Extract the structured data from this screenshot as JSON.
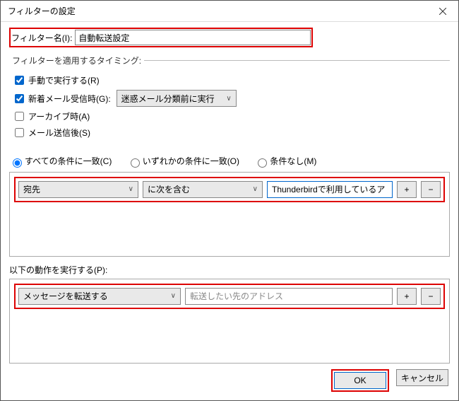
{
  "window": {
    "title": "フィルターの設定"
  },
  "filterName": {
    "label": "フィルター名(I):",
    "value": "自動転送設定"
  },
  "timing": {
    "legend": "フィルターを適用するタイミング:",
    "manual": {
      "label": "手動で実行する(R)",
      "checked": true
    },
    "newmail": {
      "label": "新着メール受信時(G):",
      "checked": true,
      "option": "迷惑メール分類前に実行"
    },
    "archive": {
      "label": "アーカイブ時(A)",
      "checked": false
    },
    "aftersend": {
      "label": "メール送信後(S)",
      "checked": false
    }
  },
  "match": {
    "all": "すべての条件に一致(C)",
    "any": "いずれかの条件に一致(O)",
    "none": "条件なし(M)",
    "selected": "all"
  },
  "condition": {
    "field": "宛先",
    "operator": "に次を含む",
    "value": "Thunderbirdで利用しているアドレス",
    "plus": "+",
    "minus": "−"
  },
  "actions": {
    "label": "以下の動作を実行する(P):",
    "action": "メッセージを転送する",
    "address": "転送したい先のアドレス",
    "plus": "+",
    "minus": "−"
  },
  "buttons": {
    "ok": "OK",
    "cancel": "キャンセル"
  }
}
